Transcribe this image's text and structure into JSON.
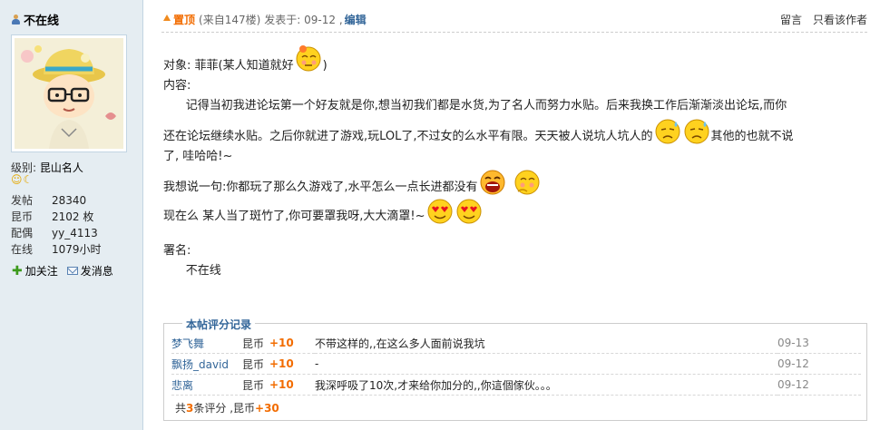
{
  "profile": {
    "username": "不在线",
    "level_label": "级别:",
    "level_value": "昆山名人",
    "stats": [
      {
        "k": "发帖",
        "v": "28340"
      },
      {
        "k": "昆币",
        "v": "2102 枚"
      },
      {
        "k": "配偶",
        "v": "yy_4113"
      },
      {
        "k": "在线",
        "v": "1079小时"
      }
    ],
    "follow_label": "加关注",
    "message_label": "发消息"
  },
  "post": {
    "pin_label": "置顶",
    "floor_info": "(来自147楼)",
    "posted_label": "发表于: 09-12 ,",
    "edit_label": "编辑",
    "reply_label": "留言",
    "author_only_label": "只看该作者",
    "line_target": "对象:  菲菲(某人知道就好",
    "line_target_end": ")",
    "line_content_label": "内容:",
    "para1_a": "      记得当初我进论坛第一个好友就是你,想当初我们都是水货,为了名人而努力水贴。后来我换工作后渐渐淡出论坛,而你",
    "para1_b": "还在论坛继续水贴。之后你就进了游戏,玩LOL了,不过女的么水平有限。天天被人说坑人坑人的",
    "para1_c": "其他的也就不说",
    "para1_d": "了, 哇哈哈!~",
    "para2": "我想说一句:你都玩了那么久游戏了,水平怎么一点长进都没有",
    "para3": "现在么 某人当了斑竹了,你可要罩我呀,大大滴罩!~",
    "sign_label": "署名:",
    "sign_name": "      不在线"
  },
  "rating": {
    "title": "本帖评分记录",
    "rows": [
      {
        "user": "梦飞舞",
        "currency": "昆币",
        "points": "+10",
        "reason": "不带这样的,,在这么多人面前说我坑",
        "date": "09-13"
      },
      {
        "user": "飘扬_david",
        "currency": "昆币",
        "points": "+10",
        "reason": "-",
        "date": "09-12"
      },
      {
        "user": "悲离",
        "currency": "昆币",
        "points": "+10",
        "reason": "我深呼吸了10次,才来给你加分的,,你這個傢伙。。。",
        "date": "09-12"
      }
    ],
    "summary_prefix": "共",
    "summary_count": "3",
    "summary_mid": "条评分 ,昆币",
    "summary_total": "+30"
  }
}
